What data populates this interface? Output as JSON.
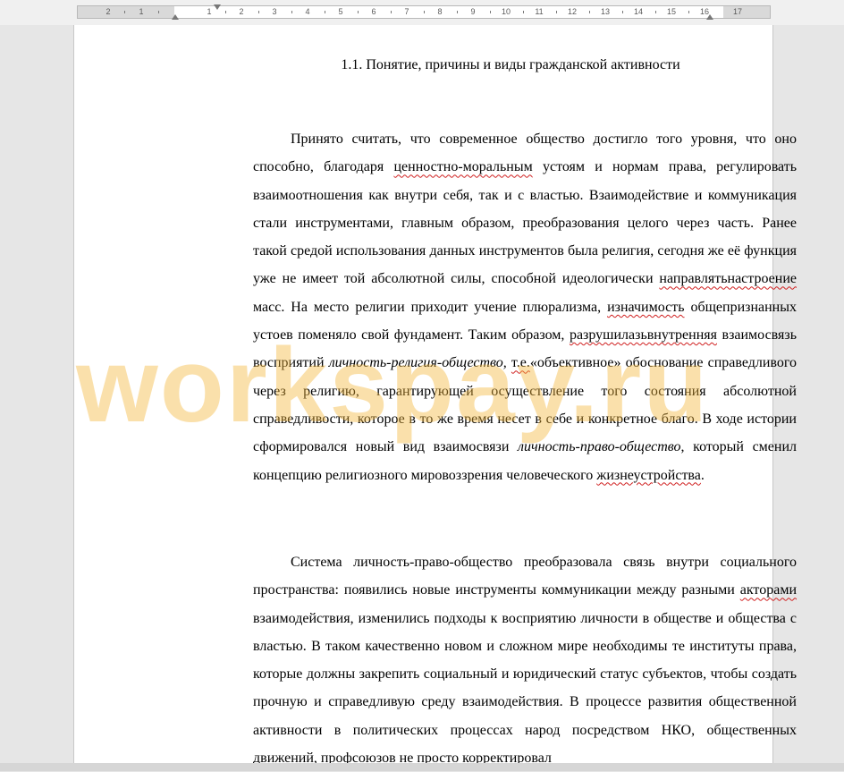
{
  "ruler": {
    "labels": [
      "2",
      "1",
      "1",
      "2",
      "3",
      "4",
      "5",
      "6",
      "7",
      "8",
      "9",
      "10",
      "11",
      "12",
      "13",
      "14",
      "15",
      "16",
      "17"
    ]
  },
  "document": {
    "heading": "1.1. Понятие, причины и виды гражданской активности",
    "paragraph_1": {
      "s1": "Принято считать, что современное общество достигло того уровня, что оно способно, благодаря ",
      "s2": "ценностно-моральным",
      "s3": " устоям и нормам права, регулировать взаимоотношения как внутри себя, так и с властью. Взаимодействие и коммуникация стали инструментами, главным образом, преобразования целого через часть. Ранее такой средой использования данных инструментов была религия, сегодня же её функция уже не имеет той абсолютной силы, способной идеологически ",
      "s4": "направлятьнастроение",
      "s5": " масс. На место религии приходит учение плюрализма, ",
      "s6": "изначимость",
      "s7": " общепризнанных устоев поменяло свой фундамент. Таким образом, ",
      "s8": "разрушилазьвнутренняя",
      "s9": " взаимосвязь восприятий ",
      "s10": "личность-религия-общество,",
      "s11": " ",
      "s12": "т.е.",
      "s13": "«объективное» обоснование справедливого через религию, гарантирующей осуществление того состояния абсолютной справедливости, которое в то же время несет в себе и конкретное благо. В ходе истории сформировался новый вид взаимосвязи ",
      "s14": "личность-право-общество",
      "s15": ", который сменил концепцию религиозного мировоззрения человеческого ",
      "s16": "жизнеустройства",
      "s17": "."
    },
    "paragraph_2": {
      "s1": "Система личность-право-общество преобразовала связь внутри социального пространства: появились новые инструменты коммуникации между разными ",
      "s2": "акторами",
      "s3": " взаимодействия, изменились подходы к восприятию личности в обществе и общества с властью. В таком качественно новом и сложном мире необходимы те институты права, которые должны закрепить социальный и юридический статус субъектов, чтобы создать прочную и справедливую среду взаимодействия. В процессе развития общественной активности в политических процессах народ посредством НКО, общественных движений, профсоюзов не просто корректировал"
    }
  },
  "watermark": {
    "text": "workspay.ru",
    "color": "#f5b73a"
  }
}
